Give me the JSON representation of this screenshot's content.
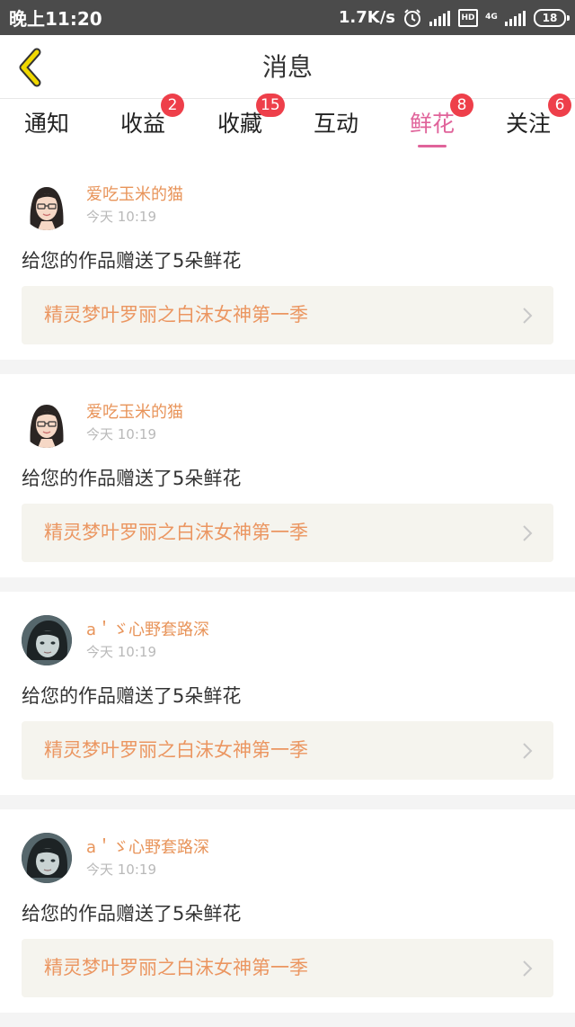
{
  "status_bar": {
    "time": "晚上11:20",
    "speed": "1.7K/s",
    "hd": "HD",
    "network": "4G",
    "battery": "18"
  },
  "header": {
    "title": "消息"
  },
  "tabs": [
    {
      "label": "通知",
      "badge": null,
      "active": false
    },
    {
      "label": "收益",
      "badge": "2",
      "active": false
    },
    {
      "label": "收藏",
      "badge": "15",
      "active": false
    },
    {
      "label": "互动",
      "badge": null,
      "active": false
    },
    {
      "label": "鲜花",
      "badge": "8",
      "active": true
    },
    {
      "label": "关注",
      "badge": "6",
      "active": false
    }
  ],
  "messages": [
    {
      "user": "爱吃玉米的猫",
      "time": "今天 10:19",
      "text": "给您的作品赠送了5朵鲜花",
      "work": "精灵梦叶罗丽之白沫女神第一季",
      "avatar": "cartoon-girl-avatar"
    },
    {
      "user": "爱吃玉米的猫",
      "time": "今天 10:19",
      "text": "给您的作品赠送了5朵鲜花",
      "work": "精灵梦叶罗丽之白沫女神第一季",
      "avatar": "cartoon-girl-avatar"
    },
    {
      "user": "a＇ゞ心野套路深",
      "time": "今天 10:19",
      "text": "给您的作品赠送了5朵鲜花",
      "work": "精灵梦叶罗丽之白沫女神第一季",
      "avatar": "photo-girl-avatar"
    },
    {
      "user": "a＇ゞ心野套路深",
      "time": "今天 10:19",
      "text": "给您的作品赠送了5朵鲜花",
      "work": "精灵梦叶罗丽之白沫女神第一季",
      "avatar": "photo-girl-avatar"
    }
  ],
  "colors": {
    "accent": "#e0639a",
    "badge": "#ee3f4a",
    "username": "#e8945a",
    "work_title": "#eb9661",
    "work_background": "#f5f4ee",
    "back_icon": "#f0d800"
  }
}
